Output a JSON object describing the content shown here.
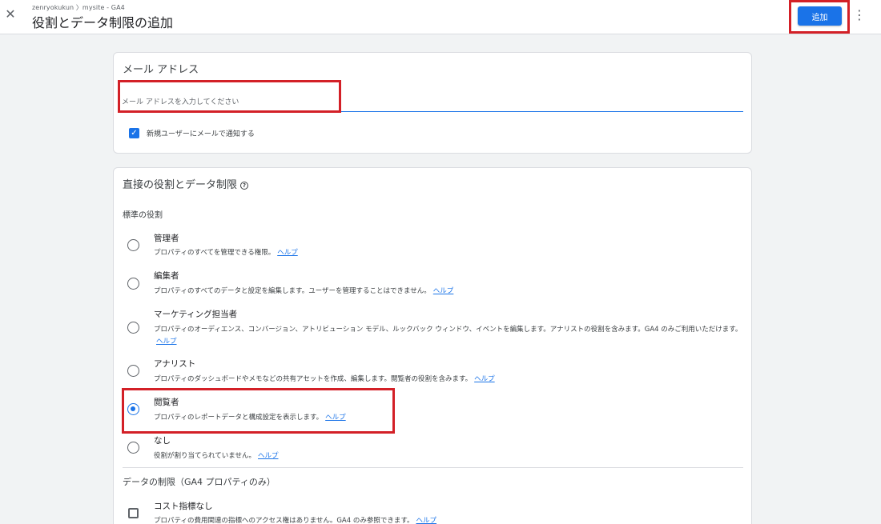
{
  "header": {
    "breadcrumb": "zenryokukun 〉mysite - GA4",
    "title": "役割とデータ制限の追加",
    "add_label": "追加",
    "close_glyph": "✕",
    "more_glyph": "⋮"
  },
  "email_card": {
    "title": "メール アドレス",
    "placeholder": "メール アドレスを入力してください",
    "value": "",
    "notify_label": "新規ユーザーにメールで通知する",
    "notify_checked": true
  },
  "roles_card": {
    "title": "直接の役割とデータ制限",
    "help_glyph": "?",
    "standard_heading": "標準の役割",
    "help_link": "ヘルプ",
    "roles": [
      {
        "name": "管理者",
        "desc": "プロパティのすべてを管理できる権限。",
        "selected": false
      },
      {
        "name": "編集者",
        "desc": "プロパティのすべてのデータと設定を編集します。ユーザーを管理することはできません。",
        "selected": false
      },
      {
        "name": "マーケティング担当者",
        "desc": "プロパティのオーディエンス、コンバージョン、アトリビューション モデル、ルックバック ウィンドウ、イベントを編集します。アナリストの役割を含みます。GA4 のみご利用いただけます。",
        "selected": false
      },
      {
        "name": "アナリスト",
        "desc": "プロパティのダッシュボードやメモなどの共有アセットを作成、編集します。閲覧者の役割を含みます。",
        "selected": false
      },
      {
        "name": "閲覧者",
        "desc": "プロパティのレポートデータと構成設定を表示します。",
        "selected": true
      },
      {
        "name": "なし",
        "desc": "役割が割り当てられていません。",
        "selected": false
      }
    ],
    "data_restrictions_heading": "データの制限（GA4 プロパティのみ）",
    "restrictions": [
      {
        "name": "コスト指標なし",
        "desc": "プロパティの費用関連の指標へのアクセス権はありません。GA4 のみ参照できます。",
        "checked": false
      }
    ]
  },
  "colors": {
    "accent": "#1a73e8",
    "highlight": "#d32027",
    "background": "#f1f3f4"
  }
}
